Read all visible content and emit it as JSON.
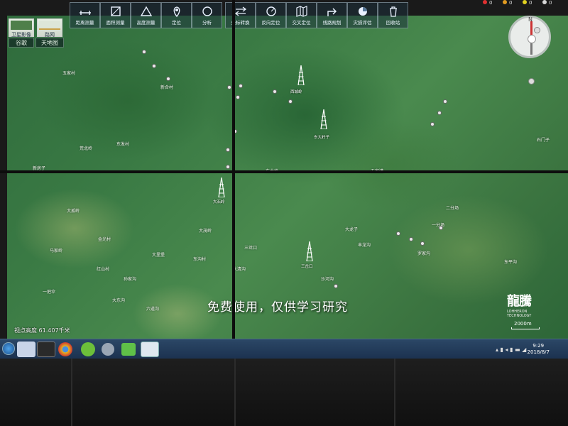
{
  "layer_switcher": {
    "tabs": [
      {
        "label": "卫星影像",
        "icon": "satellite-thumbnail"
      },
      {
        "label": "路网",
        "icon": "road-network-thumbnail"
      }
    ],
    "buttons": [
      {
        "label": "谷歌"
      },
      {
        "label": "天地图"
      }
    ]
  },
  "toolbar": {
    "tools": [
      {
        "label": "距离测量",
        "icon": "ruler-icon"
      },
      {
        "label": "面积测量",
        "icon": "area-measure-icon"
      },
      {
        "label": "高度测量",
        "icon": "height-measure-icon"
      },
      {
        "label": "定位",
        "icon": "location-pin-icon"
      },
      {
        "label": "分析",
        "icon": "circle-analysis-icon"
      },
      {
        "label": "坐标转换",
        "icon": "arrows-swap-icon"
      },
      {
        "label": "反向定位",
        "icon": "reverse-locate-icon"
      },
      {
        "label": "交叉定位",
        "icon": "map-fold-icon"
      },
      {
        "label": "线路规划",
        "icon": "route-arrow-icon"
      },
      {
        "label": "灾损评估",
        "icon": "pie-chart-icon"
      },
      {
        "label": "回收站",
        "icon": "trash-icon"
      }
    ]
  },
  "status_indicators": [
    {
      "value": "0",
      "color": "#e03030"
    },
    {
      "value": "0",
      "color": "#e09a20"
    },
    {
      "value": "0",
      "color": "#e0d020"
    },
    {
      "value": "0",
      "color": "#d8d8d8"
    }
  ],
  "compass": {
    "north_label": "N"
  },
  "map": {
    "places": [
      "石门子",
      "东大岭",
      "五家漕",
      "一分场",
      "二分场",
      "大龙子",
      "丰龙沟",
      "罗家沟",
      "东平沟",
      "三岔口",
      "大清沟",
      "大孤岭",
      "新合村",
      "五家村",
      "东发村",
      "大茂岭",
      "沙河沟",
      "金光村",
      "大里堡",
      "孙家沟",
      "马家岭",
      "东沟村",
      "荒北岭",
      "新房子",
      "红山村",
      "一把伞",
      "大东沟",
      "六道沟"
    ],
    "towers": [
      "西城岭",
      "东大岭子",
      "大石岭",
      "三岔口"
    ]
  },
  "caption": "免费使用，仅供学习研究",
  "altitude": "视点高度  61.407千米",
  "scale": "2000m",
  "watermark": {
    "text": "LOHHERON TECHNOLOGY"
  },
  "taskbar": {
    "apps": [
      "start-orb",
      "user-icon",
      "terminal-icon",
      "chrome-icon",
      "wechat-icon",
      "network-app-icon",
      "message-icon",
      "map-app-icon"
    ],
    "time": "9:29",
    "date": "2018/8/7"
  }
}
